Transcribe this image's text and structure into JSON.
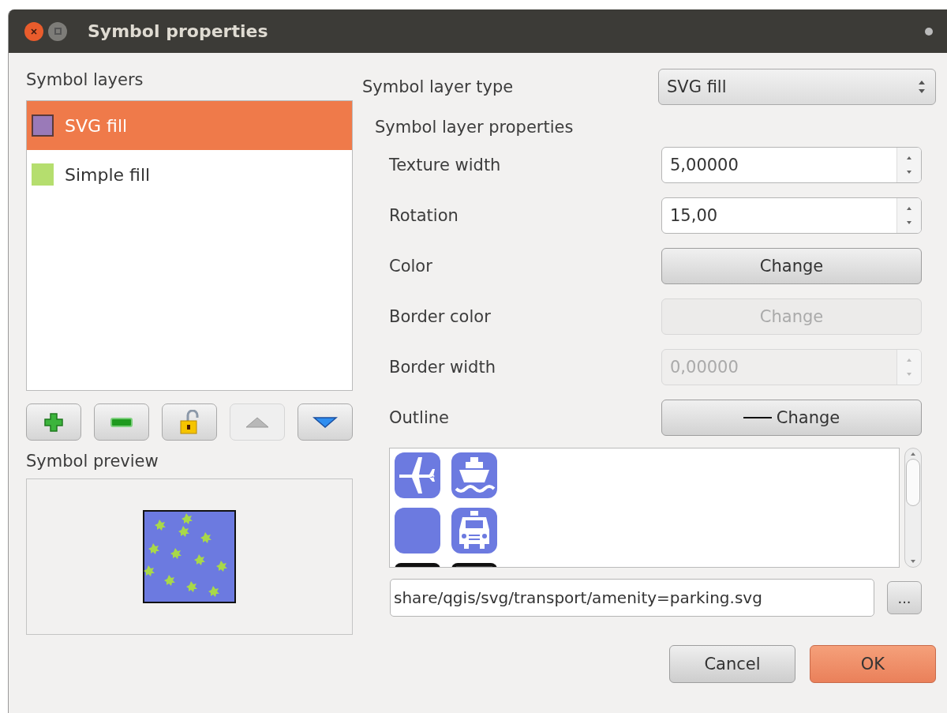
{
  "window": {
    "title": "Symbol properties"
  },
  "symbol_layers": {
    "label": "Symbol layers",
    "items": [
      {
        "label": "SVG fill",
        "color": "#9a7ab8",
        "selected": true
      },
      {
        "label": "Simple fill",
        "color": "#b5de6e",
        "selected": false
      }
    ],
    "buttons": [
      {
        "kind": "add",
        "disabled": false
      },
      {
        "kind": "remove",
        "disabled": false
      },
      {
        "kind": "lock",
        "disabled": false
      },
      {
        "kind": "up",
        "disabled": true
      },
      {
        "kind": "down",
        "disabled": false
      }
    ]
  },
  "symbol_preview": {
    "label": "Symbol preview"
  },
  "symbol_layer_type": {
    "label": "Symbol layer type",
    "value": "SVG fill"
  },
  "properties": {
    "label": "Symbol layer properties",
    "rows": [
      {
        "label": "Texture width",
        "kind": "spin",
        "value": "5,00000",
        "disabled": false
      },
      {
        "label": "Rotation",
        "kind": "spin",
        "value": "15,00",
        "disabled": false
      },
      {
        "label": "Color",
        "kind": "button",
        "value": "Change",
        "disabled": false
      },
      {
        "label": "Border color",
        "kind": "button",
        "value": "Change",
        "disabled": true
      },
      {
        "label": "Border width",
        "kind": "spin",
        "value": "0,00000",
        "disabled": true
      },
      {
        "label": "Outline",
        "kind": "line-button",
        "value": "Change",
        "disabled": false
      }
    ]
  },
  "svg_path": {
    "value": "share/qgis/svg/transport/amenity=parking.svg",
    "browse": "..."
  },
  "buttons": [
    {
      "label": "Cancel",
      "default": false
    },
    {
      "label": "OK",
      "default": true
    }
  ]
}
